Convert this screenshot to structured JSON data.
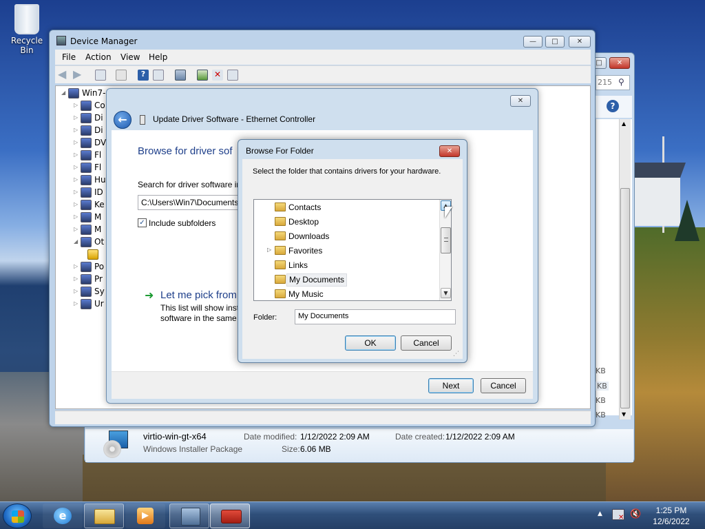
{
  "desktop": {
    "recycle_bin_label": "Recycle Bin"
  },
  "explorer": {
    "search_fragment": "215",
    "file": {
      "name": "virtio-win-gt-x64",
      "type": "Windows Installer Package",
      "date_modified_label": "Date modified:",
      "date_modified": "1/12/2022 2:09 AM",
      "date_created_label": "Date created:",
      "date_created": "1/12/2022 2:09 AM",
      "size_label": "Size:",
      "size": "6.06 MB"
    },
    "size_units": [
      "KB",
      "KB",
      "KB",
      "KB"
    ]
  },
  "device_manager": {
    "title": "Device Manager",
    "menu": [
      "File",
      "Action",
      "View",
      "Help"
    ],
    "tree": [
      {
        "label": "Win7-",
        "expander": "◢"
      },
      {
        "label": "Co",
        "expander": "▷"
      },
      {
        "label": "Di",
        "expander": "▷"
      },
      {
        "label": "Di",
        "expander": "▷"
      },
      {
        "label": "DV",
        "expander": "▷"
      },
      {
        "label": "Fl",
        "expander": "▷"
      },
      {
        "label": "Fl",
        "expander": "▷"
      },
      {
        "label": "Hu",
        "expander": "▷"
      },
      {
        "label": "ID",
        "expander": "▷"
      },
      {
        "label": "Ke",
        "expander": "▷"
      },
      {
        "label": "M",
        "expander": "▷"
      },
      {
        "label": "M",
        "expander": "▷"
      },
      {
        "label": "Ot",
        "expander": "◢"
      },
      {
        "label": "",
        "expander": ""
      },
      {
        "label": "Po",
        "expander": "▷"
      },
      {
        "label": "Pr",
        "expander": "▷"
      },
      {
        "label": "Sy",
        "expander": "▷"
      },
      {
        "label": "Ur",
        "expander": "▷"
      }
    ]
  },
  "wizard": {
    "title": "Update Driver Software - Ethernet Controller",
    "heading": "Browse for driver sof",
    "search_label": "Search for driver software in",
    "path_value": "C:\\Users\\Win7\\Documents",
    "include_subfolders": "Include subfolders",
    "pick_heading": "Let me pick from",
    "pick_desc_line1": "This list will show inst",
    "pick_desc_line2": "software in the same",
    "next": "Next",
    "cancel": "Cancel"
  },
  "browse": {
    "title": "Browse For Folder",
    "instruction": "Select the folder that contains drivers for your hardware.",
    "folders": [
      {
        "name": "Contacts",
        "expander": ""
      },
      {
        "name": "Desktop",
        "expander": ""
      },
      {
        "name": "Downloads",
        "expander": ""
      },
      {
        "name": "Favorites",
        "expander": "▷"
      },
      {
        "name": "Links",
        "expander": ""
      },
      {
        "name": "My Documents",
        "expander": "",
        "selected": true
      },
      {
        "name": "My Music",
        "expander": ""
      }
    ],
    "folder_label": "Folder:",
    "folder_value": "My Documents",
    "ok": "OK",
    "cancel": "Cancel"
  },
  "taskbar": {
    "time": "1:25 PM",
    "date": "12/6/2022"
  }
}
